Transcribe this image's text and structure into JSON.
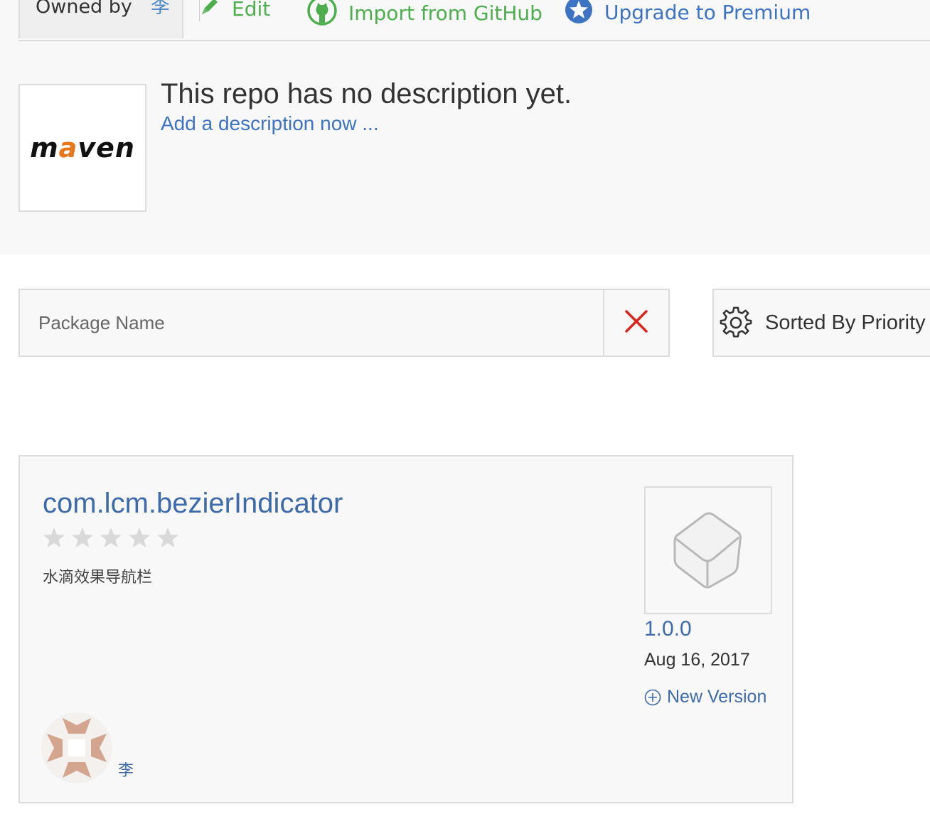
{
  "toolbar": {
    "owned_by_label": "Owned by",
    "owner_link": "李",
    "edit_label": "Edit",
    "import_label": "Import from GitHub",
    "premium_label": "Upgrade to Premium"
  },
  "repo": {
    "logo_text_prefix": "m",
    "logo_text_accent": "a",
    "logo_text_suffix": "ven",
    "description_empty": "This repo has no description yet.",
    "add_description_link": "Add a description now ..."
  },
  "search": {
    "placeholder": "Package Name",
    "value": ""
  },
  "sort": {
    "label": "Sorted By Priority"
  },
  "packages": [
    {
      "name": "com.lcm.bezierIndicator",
      "rating": 0,
      "rating_max": 5,
      "description": "水滴效果导航栏",
      "version": "1.0.0",
      "date": "Aug 16, 2017",
      "new_version_label": "New Version",
      "owner": "李"
    }
  ],
  "colors": {
    "link_blue": "#3d6aa8",
    "action_green": "#4cae4c",
    "premium_blue": "#3d73c3",
    "clear_red": "#d9241c",
    "star_gray": "#d9d9d9",
    "maven_orange": "#e8761b"
  },
  "icons": {
    "edit": "pencil-icon",
    "github": "github-icon",
    "premium": "star-circle-icon",
    "clear": "close-icon",
    "sort": "gear-icon",
    "package": "box-icon",
    "new_version": "plus-circle-icon"
  }
}
